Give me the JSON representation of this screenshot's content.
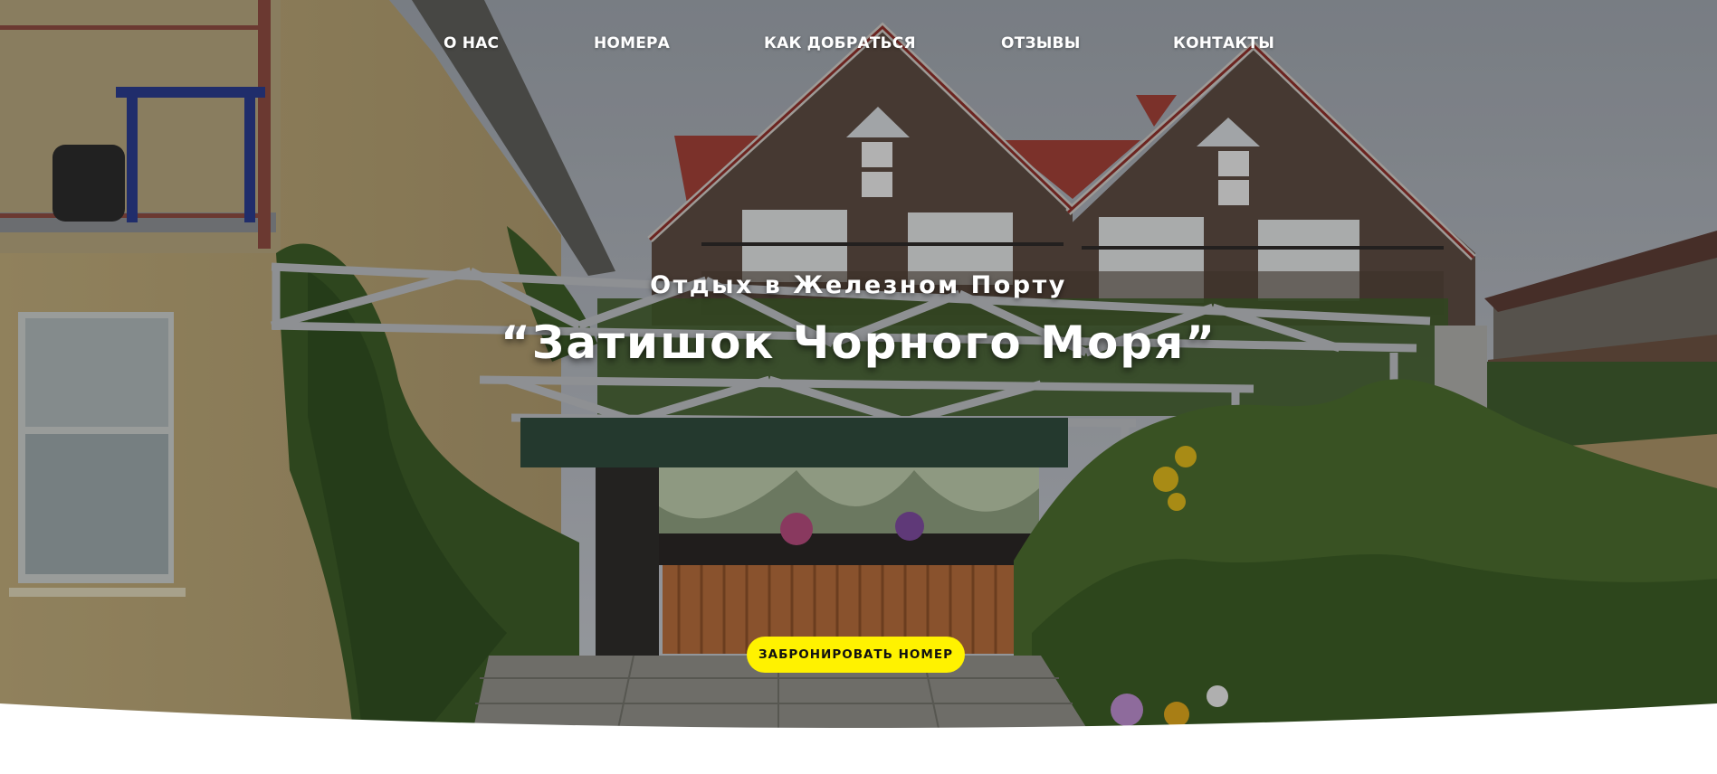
{
  "nav": {
    "items": [
      {
        "label": "О НАС"
      },
      {
        "label": "НОМЕРА"
      },
      {
        "label": "КАК ДОБРАТЬСЯ"
      },
      {
        "label": "ОТЗЫВЫ"
      },
      {
        "label": "КОНТАКТЫ"
      }
    ]
  },
  "hero": {
    "subtitle": "Отдых в Железном Порту",
    "title": "“Затишок Чорного Моря”",
    "cta_label": "ЗАБРОНИРОВАТЬ НОМЕР"
  },
  "colors": {
    "cta_background": "#fff200",
    "nav_text": "#ffffff",
    "page_background": "#ffffff"
  }
}
